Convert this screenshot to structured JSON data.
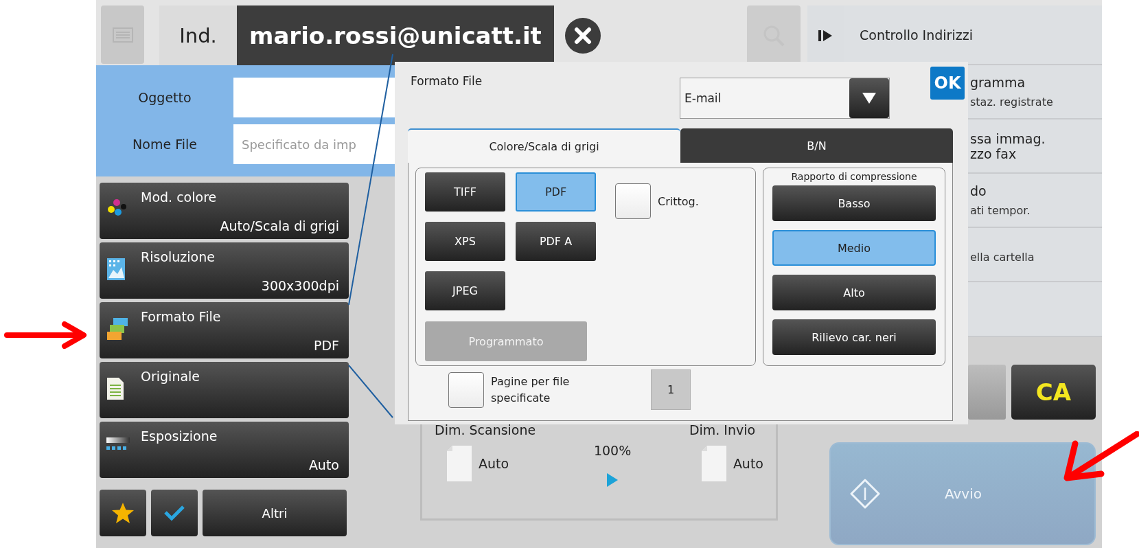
{
  "toolbar": {
    "address_label": "Ind.",
    "address": "mario.rossi@unicatt.it"
  },
  "form": [
    {
      "label": "Oggetto"
    },
    {
      "label": "Nome File",
      "placeholder": "Specificato da imp"
    }
  ],
  "settings": [
    {
      "name": "Mod. colore",
      "value": "Auto/Scala di grigi"
    },
    {
      "name": "Risoluzione",
      "value": "300x300dpi"
    },
    {
      "name": "Formato File",
      "value": "PDF"
    },
    {
      "name": "Originale"
    },
    {
      "name": "Esposizione",
      "value": "Auto"
    }
  ],
  "bottom_button": "Altri",
  "right_panel": [
    {
      "title_lines": [
        "Controllo Indirizzi"
      ]
    },
    {
      "title_lines": [
        "gramma"
      ],
      "subtitle": "staz. registrate"
    },
    {
      "title_lines": [
        "ssa immag.",
        "zzo fax"
      ]
    },
    {
      "title_lines": [
        "do"
      ],
      "subtitle": "ati tempor."
    },
    {
      "subtitle": "ella cartella"
    }
  ],
  "dialog": {
    "title": "Formato File",
    "destination": "E-mail",
    "ok": "OK",
    "tabs": [
      {
        "label": "Colore/Scala di grigi",
        "selected": true
      },
      {
        "label": "B/N",
        "selected": false
      }
    ],
    "formats": [
      {
        "label": "TIFF",
        "selected": false
      },
      {
        "label": "PDF",
        "selected": true
      },
      {
        "label": "XPS",
        "selected": false
      },
      {
        "label": "PDF A",
        "selected": false
      },
      {
        "label": "JPEG",
        "selected": false
      }
    ],
    "programmed": {
      "label": "Programmato",
      "disabled": true
    },
    "encrypt": {
      "label": "Crittog.",
      "checked": false
    },
    "compression": {
      "title": "Rapporto di compressione",
      "options": [
        {
          "label": "Basso",
          "selected": false
        },
        {
          "label": "Medio",
          "selected": true
        },
        {
          "label": "Alto",
          "selected": false
        },
        {
          "label": "Rilievo car. neri",
          "selected": false
        }
      ]
    },
    "pages_per_file": {
      "label": "Pagine per file specificate",
      "checked": false,
      "value": "1"
    }
  },
  "size": {
    "scan_label": "Dim. Scansione",
    "scan_value": "Auto",
    "ratio": "100%",
    "send_label": "Dim. Invio",
    "send_value": "Auto"
  },
  "keys": {
    "clear_all": "CA",
    "start": {
      "label": "Avvio",
      "disabled": true
    }
  }
}
